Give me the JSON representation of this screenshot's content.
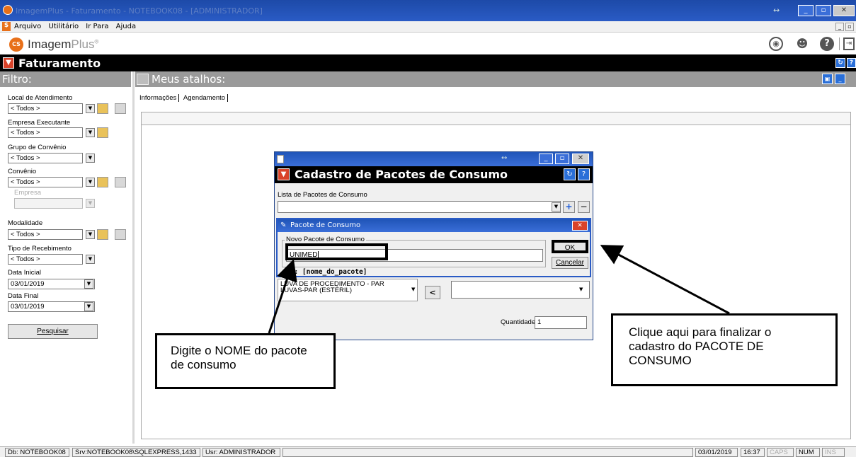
{
  "window": {
    "title": "ImagemPlus - Faturamento - NOTEBOOK08 - [ADMINISTRADOR]"
  },
  "menu": {
    "items": [
      "Arquivo",
      "Utilitário",
      "Ir Para",
      "Ajuda"
    ]
  },
  "app": {
    "logo_name": "Imagem",
    "logo_suffix": "Plus",
    "logo_mark": "®",
    "icon_text": "CS"
  },
  "module": {
    "title": "Faturamento"
  },
  "filter": {
    "header": "Filtro:",
    "local_label": "Local de Atendimento",
    "local_value": "< Todos >",
    "empresa_exec_label": "Empresa Executante",
    "empresa_exec_value": "< Todos >",
    "grupo_label": "Grupo de Convênio",
    "grupo_value": "< Todos >",
    "convenio_label": "Convênio",
    "convenio_value": "< Todos >",
    "empresa_label": "Empresa",
    "empresa_value": "",
    "modalidade_label": "Modalidade",
    "modalidade_value": "< Todos >",
    "tipo_label": "Tipo de Recebimento",
    "tipo_value": "< Todos >",
    "data_inicial_label": "Data Inicial",
    "data_inicial_value": "03/01/2019",
    "data_final_label": "Data Final",
    "data_final_value": "03/01/2019",
    "search_button": "Pesquisar"
  },
  "shortcuts": {
    "header": "Meus atalhos:",
    "tabs": [
      "Informações",
      "Agendamento"
    ]
  },
  "dialog": {
    "title": "Cadastro de Pacotes de Consumo",
    "list_label": "Lista de Pacotes de Consumo",
    "list_value": "",
    "item_line1": "LUVA DE PROCEDIMENTO - PAR",
    "item_line2": "LUVAS-PAR (ESTÉRIL)",
    "move_button": "<",
    "quantity_label": "Quantidade",
    "quantity_value": "1"
  },
  "subdialog": {
    "title": "Pacote de Consumo",
    "group_label": "Novo Pacote de Consumo",
    "name_value": "UNIMED",
    "hint": "Ex: [nome_do_pacote]",
    "ok_button": "OK",
    "cancel_button": "Cancelar"
  },
  "callouts": {
    "left": "Digite o NOME do pacote de consumo",
    "right": "Clique aqui para finalizar o cadastro do PACOTE DE CONSUMO"
  },
  "statusbar": {
    "db": "Db: NOTEBOOK08",
    "srv": "Srv:NOTEBOOK08\\SQLEXPRESS,1433",
    "usr": "Usr: ADMINISTRADOR",
    "date": "03/01/2019",
    "time": "16:37",
    "caps": "CAPS",
    "num": "NUM",
    "ins": "INS"
  },
  "colors": {
    "accent": "#2a5bc5",
    "header_black": "#000000",
    "panel_gray": "#9a9a9a",
    "dialog_red": "#d9432a"
  }
}
